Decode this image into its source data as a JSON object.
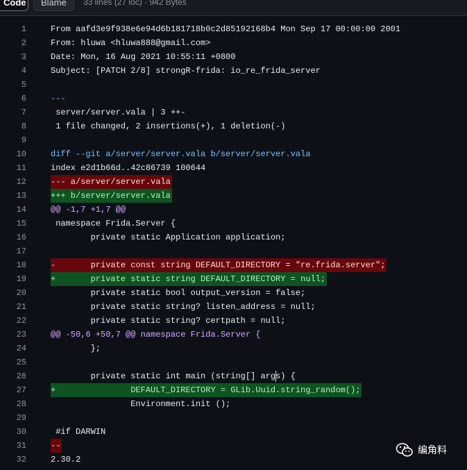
{
  "toolbar": {
    "tab_code": "Code",
    "tab_blame": "Blame",
    "file_meta": "33 lines (27 loc) · 942 Bytes"
  },
  "lines": [
    {
      "n": "1",
      "text": "From aafd3e9f938e6e94d6b181718b0c2d85192168b4 Mon Sep 17 00:00:00 2001",
      "type": "normal"
    },
    {
      "n": "2",
      "text": "From: hluwa <hluwa888@gmail.com>",
      "type": "normal"
    },
    {
      "n": "3",
      "text": "Date: Mon, 16 Aug 2021 10:55:11 +0800",
      "type": "normal"
    },
    {
      "n": "4",
      "text": "Subject: [PATCH 2/8] strongR-frida: io_re_frida_server",
      "type": "normal"
    },
    {
      "n": "5",
      "text": "",
      "type": "normal"
    },
    {
      "n": "6",
      "text": "---",
      "type": "blue"
    },
    {
      "n": "7",
      "text": " server/server.vala | 3 ++-",
      "type": "normal"
    },
    {
      "n": "8",
      "text": " 1 file changed, 2 insertions(+), 1 deletion(-)",
      "type": "normal"
    },
    {
      "n": "9",
      "text": "",
      "type": "normal"
    },
    {
      "n": "10",
      "text": "diff --git a/server/server.vala b/server/server.vala",
      "type": "blue"
    },
    {
      "n": "11",
      "text": "index e2d1b66d..42c86739 100644",
      "type": "normal"
    },
    {
      "n": "12",
      "text": "--- a/server/server.vala",
      "type": "del"
    },
    {
      "n": "13",
      "text": "+++ b/server/server.vala",
      "type": "add"
    },
    {
      "n": "14",
      "text": "@@ -1,7 +1,7 @@",
      "type": "hunk"
    },
    {
      "n": "15",
      "text": " namespace Frida.Server {",
      "type": "normal"
    },
    {
      "n": "16",
      "text": "        private static Application application;",
      "type": "normal"
    },
    {
      "n": "17",
      "text": "",
      "type": "normal"
    },
    {
      "n": "18",
      "text": "-       private const string DEFAULT_DIRECTORY = \"re.frida.server\";",
      "type": "del"
    },
    {
      "n": "19",
      "text": "+       private static string DEFAULT_DIRECTORY = null;",
      "type": "add"
    },
    {
      "n": "20",
      "text": "        private static bool output_version = false;",
      "type": "normal"
    },
    {
      "n": "21",
      "text": "        private static string? listen_address = null;",
      "type": "normal"
    },
    {
      "n": "22",
      "text": "        private static string? certpath = null;",
      "type": "normal"
    },
    {
      "n": "23",
      "text": "@@ -50,6 +50,7 @@ namespace Frida.Server {",
      "type": "hunk"
    },
    {
      "n": "24",
      "text": "        };",
      "type": "normal"
    },
    {
      "n": "25",
      "text": "",
      "type": "normal"
    },
    {
      "n": "26",
      "text": "        private static int main (string[] args) {",
      "type": "normal",
      "cursor": true
    },
    {
      "n": "27",
      "text": "+               DEFAULT_DIRECTORY = GLib.Uuid.string_random();",
      "type": "add"
    },
    {
      "n": "28",
      "text": "                Environment.init ();",
      "type": "normal"
    },
    {
      "n": "29",
      "text": "",
      "type": "normal"
    },
    {
      "n": "30",
      "text": " #if DARWIN",
      "type": "normal"
    },
    {
      "n": "31",
      "text": "--",
      "type": "del"
    },
    {
      "n": "32",
      "text": "2.30.2",
      "type": "normal"
    }
  ],
  "watermark": {
    "text": "编角料",
    "icon": "wechat-icon"
  },
  "colors": {
    "background": "#0d1117",
    "deletion_bg": "#67060c",
    "addition_bg": "#0f5323",
    "hunk": "#d2a8ff",
    "meta_blue": "#79c0ff"
  }
}
